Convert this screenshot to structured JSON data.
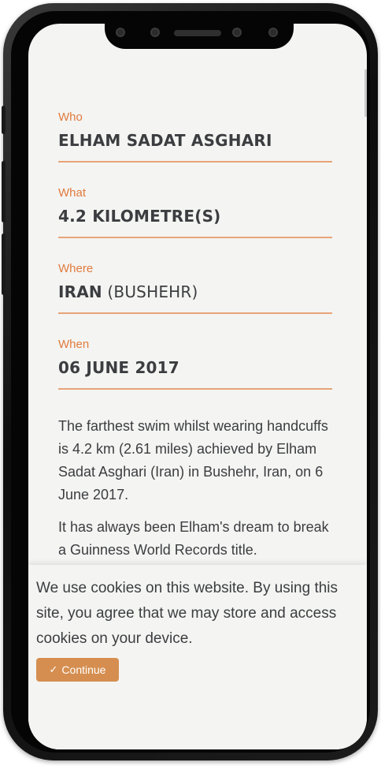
{
  "record": {
    "fields": [
      {
        "label": "Who",
        "value": "ELHAM SADAT ASGHARI",
        "sub": ""
      },
      {
        "label": "What",
        "value": "4.2 KILOMETRE(S)",
        "sub": ""
      },
      {
        "label": "Where",
        "value": "IRAN",
        "sub": " (BUSHEHR)"
      },
      {
        "label": "When",
        "value": "06 JUNE 2017",
        "sub": ""
      }
    ],
    "paragraph_1": "The farthest swim whilst wearing handcuffs is 4.2 km (2.61 miles) achieved by Elham Sadat Asghari (Iran) in Bushehr, Iran, on 6 June 2017.",
    "paragraph_2": "It has always been Elham's dream to break a Guinness World Records title."
  },
  "cookie_banner": {
    "text": "We use cookies on this website. By using this site, you agree that we may store and access cookies on your device.",
    "button_label": "Continue",
    "button_icon": "check-icon"
  },
  "colors": {
    "accent": "#e07b3e",
    "rule": "#e8a479",
    "button": "#d58e4f",
    "text": "#3b3d40",
    "background": "#f4f4f2"
  }
}
